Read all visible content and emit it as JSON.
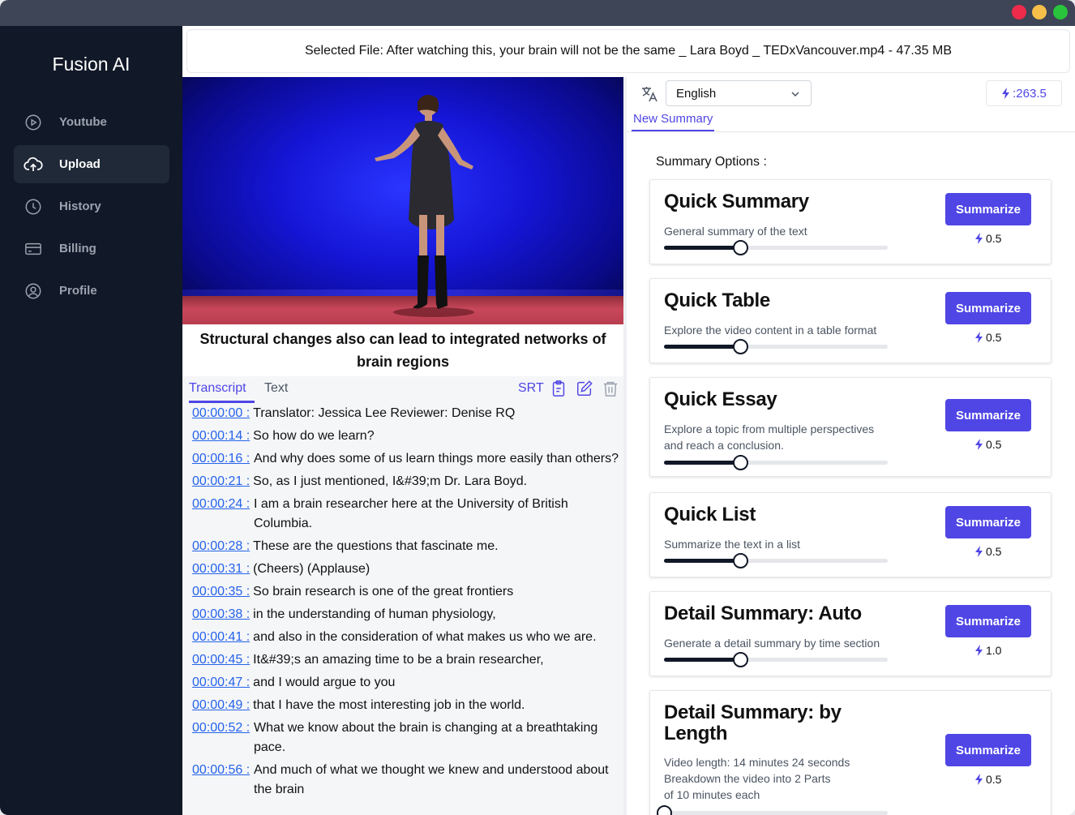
{
  "app": {
    "brand": "Fusion AI"
  },
  "colors": {
    "accent": "#4f46e5",
    "sidebar_bg": "#111827",
    "link": "#2563eb"
  },
  "sidebar": {
    "items": [
      {
        "label": "Youtube",
        "icon": "play-circle-icon",
        "active": false
      },
      {
        "label": "Upload",
        "icon": "cloud-upload-icon",
        "active": true
      },
      {
        "label": "History",
        "icon": "clock-icon",
        "active": false
      },
      {
        "label": "Billing",
        "icon": "credit-card-icon",
        "active": false
      },
      {
        "label": "Profile",
        "icon": "user-circle-icon",
        "active": false
      }
    ]
  },
  "file_bar": {
    "text": "Selected File: After watching this, your brain will not be the same _ Lara Boyd _ TEDxVancouver.mp4 - 47.35 MB"
  },
  "video": {
    "caption": "Structural changes also can lead to integrated networks of brain regions"
  },
  "transcript_tabs": {
    "transcript": "Transcript",
    "text": "Text",
    "srt": "SRT"
  },
  "transcript": [
    {
      "time": "00:00:00 :",
      "text": "Translator: Jessica Lee Reviewer: Denise RQ",
      "wrap": false
    },
    {
      "time": "00:00:14 :",
      "text": "So how do we learn?",
      "wrap": false
    },
    {
      "time": "00:00:16 :",
      "text": "And why does some of us learn things more easily than others?",
      "wrap": true
    },
    {
      "time": "00:00:21 :",
      "text": "So, as I just mentioned, I&#39;m Dr. Lara Boyd.",
      "wrap": false
    },
    {
      "time": "00:00:24 :",
      "text": "I am a brain researcher here at the University of British Columbia.",
      "wrap": true
    },
    {
      "time": "00:00:28 :",
      "text": "These are the questions that fascinate me.",
      "wrap": false
    },
    {
      "time": "00:00:31 :",
      "text": "(Cheers) (Applause)",
      "wrap": false
    },
    {
      "time": "00:00:35 :",
      "text": "So brain research is one of the great frontiers",
      "wrap": false
    },
    {
      "time": "00:00:38 :",
      "text": "in the understanding of human physiology,",
      "wrap": false
    },
    {
      "time": "00:00:41 :",
      "text": "and also in the consideration of what makes us who we are.",
      "wrap": false
    },
    {
      "time": "00:00:45 :",
      "text": "It&#39;s an amazing time to be a brain researcher,",
      "wrap": false
    },
    {
      "time": "00:00:47 :",
      "text": "and I would argue to you",
      "wrap": false
    },
    {
      "time": "00:00:49 :",
      "text": "that I have the most interesting job in the world.",
      "wrap": false
    },
    {
      "time": "00:00:52 :",
      "text": "What we know about the brain is changing at a breathtaking pace.",
      "wrap": true
    },
    {
      "time": "00:00:56 :",
      "text": "And much of what we thought we knew and understood about the brain",
      "wrap": true
    }
  ],
  "right_panel": {
    "language": "English",
    "credits": ":263.5",
    "tab": "New Summary",
    "options_label": "Summary Options :"
  },
  "summary_cards": [
    {
      "title": "Quick Summary",
      "desc": [
        "General summary of the text"
      ],
      "button": "Summarize",
      "cost": "0.5",
      "slider": 0.34
    },
    {
      "title": "Quick Table",
      "desc": [
        "Explore the video content in a table format"
      ],
      "button": "Summarize",
      "cost": "0.5",
      "slider": 0.34
    },
    {
      "title": "Quick Essay",
      "desc": [
        "Explore a topic from multiple perspectives",
        "and reach a conclusion."
      ],
      "button": "Summarize",
      "cost": "0.5",
      "slider": 0.34
    },
    {
      "title": "Quick List",
      "desc": [
        "Summarize the text in a list"
      ],
      "button": "Summarize",
      "cost": "0.5",
      "slider": 0.34
    },
    {
      "title": "Detail Summary: Auto",
      "desc": [
        "Generate a detail summary by time section"
      ],
      "button": "Summarize",
      "cost": "1.0",
      "slider": 0.34
    },
    {
      "title": "Detail Summary: by Length",
      "desc": [
        "Video length: 14 minutes 24 seconds",
        "Breakdown the video into 2 Parts",
        "of 10 minutes each"
      ],
      "button": "Summarize",
      "cost": "0.5",
      "slider": 0.0
    }
  ]
}
